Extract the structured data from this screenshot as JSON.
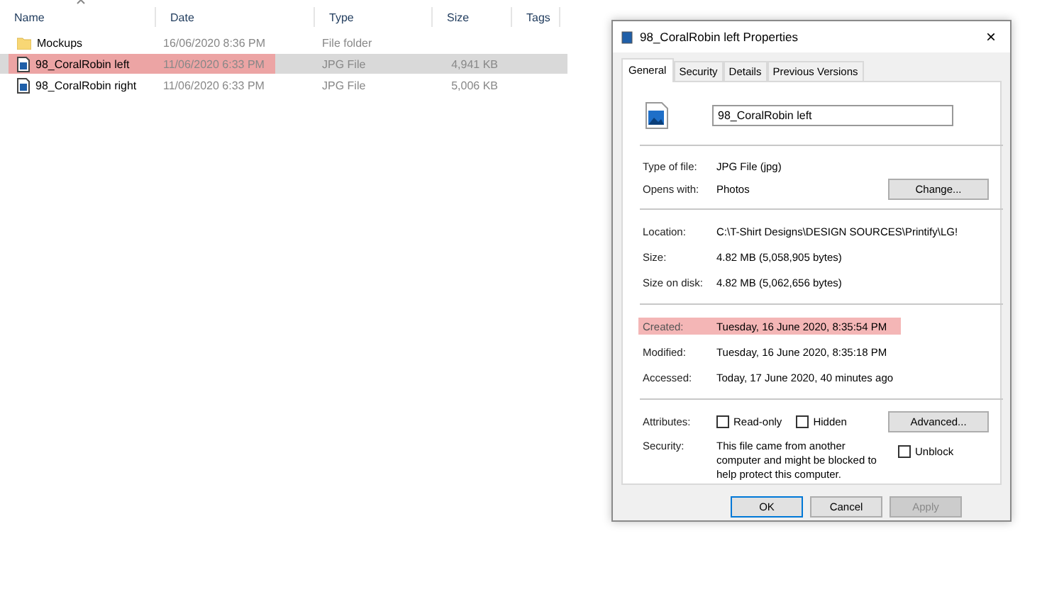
{
  "explorer": {
    "columns": [
      {
        "label": "Name",
        "sorted": true
      },
      {
        "label": "Date",
        "sorted": false
      },
      {
        "label": "Type",
        "sorted": false
      },
      {
        "label": "Size",
        "sorted": false
      },
      {
        "label": "Tags",
        "sorted": false
      }
    ],
    "rows": [
      {
        "kind": "folder",
        "name": "Mockups",
        "date": "16/06/2020 8:36 PM",
        "type": "File folder",
        "size": "",
        "selected": false,
        "highlighted": false
      },
      {
        "kind": "image",
        "name": "98_CoralRobin left",
        "date": "11/06/2020 6:33 PM",
        "type": "JPG File",
        "size": "4,941 KB",
        "selected": true,
        "highlighted": true
      },
      {
        "kind": "image",
        "name": "98_CoralRobin right",
        "date": "11/06/2020 6:33 PM",
        "type": "JPG File",
        "size": "5,006 KB",
        "selected": false,
        "highlighted": false
      }
    ]
  },
  "dialog": {
    "title": "98_CoralRobin left Properties",
    "close": "×",
    "tabs": [
      {
        "label": "General",
        "selected": true
      },
      {
        "label": "Security",
        "selected": false
      },
      {
        "label": "Details",
        "selected": false
      },
      {
        "label": "Previous Versions",
        "selected": false
      }
    ],
    "file_name": "98_CoralRobin left",
    "sections": [
      [
        {
          "label": "Type of file:",
          "value": "JPG File (jpg)",
          "highlighted": false
        },
        {
          "label": "Opens with:",
          "value": "Photos",
          "button": "Change...",
          "highlighted": false
        }
      ],
      [
        {
          "label": "Location:",
          "value": "C:\\T-Shirt Designs\\DESIGN SOURCES\\Printify\\LG!",
          "highlighted": false
        },
        {
          "label": "Size:",
          "value": "4.82 MB (5,058,905 bytes)",
          "highlighted": false
        },
        {
          "label": "Size on disk:",
          "value": "4.82 MB (5,062,656 bytes)",
          "highlighted": false
        }
      ],
      [
        {
          "label": "Created:",
          "value": "Tuesday, 16 June 2020, 8:35:54 PM",
          "highlighted": true
        },
        {
          "label": "Modified:",
          "value": "Tuesday, 16 June 2020, 8:35:18 PM",
          "highlighted": false
        },
        {
          "label": "Accessed:",
          "value": "Today, 17 June 2020, 40 minutes ago",
          "highlighted": false
        }
      ]
    ],
    "attributes_label": "Attributes:",
    "attributes": [
      {
        "label": "Read-only",
        "checked": false
      },
      {
        "label": "Hidden",
        "checked": false
      }
    ],
    "advanced_button": "Advanced...",
    "security_label": "Security:",
    "security_text": "This file came from another computer and might be blocked to help protect this computer.",
    "unblock": {
      "label": "Unblock",
      "checked": false
    },
    "buttons": [
      {
        "label": "OK",
        "default": true,
        "disabled": false
      },
      {
        "label": "Cancel",
        "default": false,
        "disabled": false
      },
      {
        "label": "Apply",
        "default": false,
        "disabled": true
      }
    ]
  }
}
